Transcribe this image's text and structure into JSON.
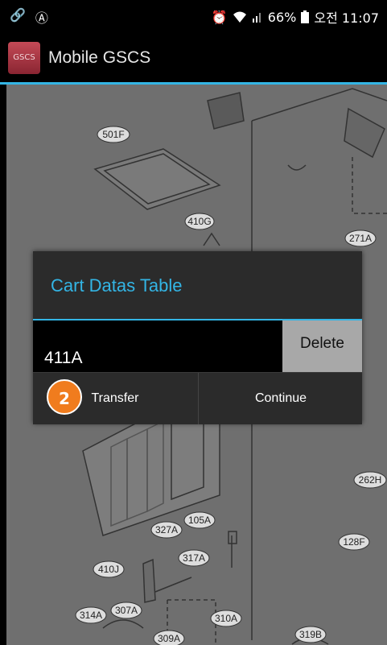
{
  "status_bar": {
    "battery": "66%",
    "time": "오전 11:07",
    "icons": [
      "link-icon",
      "accessibility-icon",
      "alarm-icon",
      "wifi-icon",
      "signal-icon",
      "battery-icon"
    ]
  },
  "app": {
    "logo_text": "GSCS",
    "title": "Mobile GSCS",
    "accent_color": "#33b5e5"
  },
  "diagram_labels": [
    "501F",
    "410G",
    "271A",
    "262H",
    "105A",
    "327A",
    "317A",
    "410J",
    "128F",
    "314A",
    "307A",
    "310A",
    "309A",
    "319B"
  ],
  "dialog": {
    "title": "Cart Datas Table",
    "row": {
      "code": "411A",
      "delete_label": "Delete"
    },
    "buttons": {
      "transfer": "Transfer",
      "continue": "Continue"
    },
    "badge": "2"
  }
}
